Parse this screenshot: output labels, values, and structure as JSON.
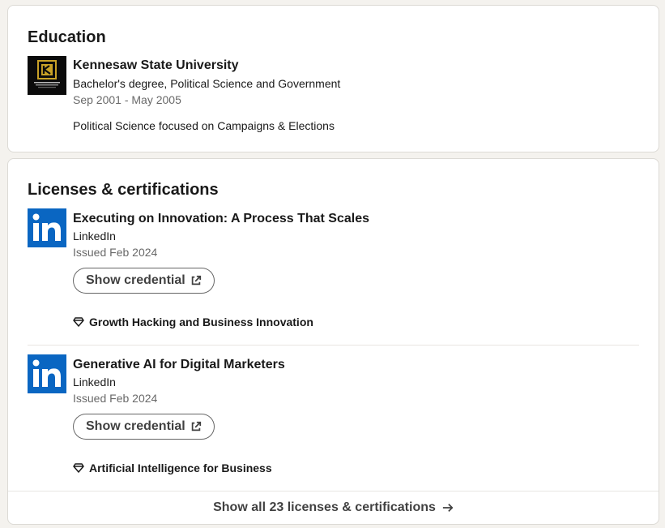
{
  "education": {
    "title": "Education",
    "items": [
      {
        "school": "Kennesaw State University",
        "degree": "Bachelor's degree, Political Science and Government",
        "dates": "Sep 2001 - May 2005",
        "description": "Political Science focused on Campaigns & Elections",
        "logo_icon": "ksu-logo"
      }
    ]
  },
  "licenses": {
    "title": "Licenses & certifications",
    "items": [
      {
        "name": "Executing on Innovation: A Process That Scales",
        "issuer": "LinkedIn",
        "issued": "Issued Feb 2024",
        "button_label": "Show credential",
        "skill": "Growth Hacking and Business Innovation",
        "logo_icon": "linkedin-logo"
      },
      {
        "name": "Generative AI for Digital Marketers",
        "issuer": "LinkedIn",
        "issued": "Issued Feb 2024",
        "button_label": "Show credential",
        "skill": "Artificial Intelligence for Business",
        "logo_icon": "linkedin-logo"
      }
    ],
    "show_all_label": "Show all 23 licenses & certifications"
  },
  "colors": {
    "linkedin_blue": "#0a66c2",
    "card_border": "#dcdad5",
    "page_background": "#f4f2ee"
  }
}
